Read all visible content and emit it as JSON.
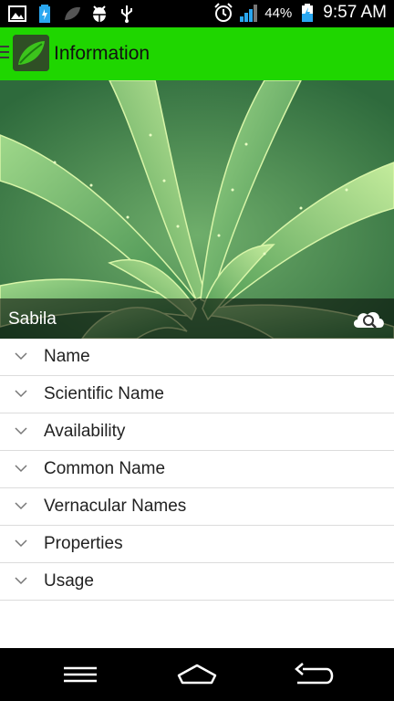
{
  "status_bar": {
    "battery_percent": "44%",
    "time": "9:57 AM",
    "icons": [
      "gallery-icon",
      "battery-saver-icon",
      "leaf-icon",
      "android-debug-icon",
      "usb-icon",
      "alarm-icon",
      "signal-icon",
      "battery-charging-icon"
    ]
  },
  "action_bar": {
    "title": "Information",
    "color": "#1fd600"
  },
  "hero": {
    "caption": "Sabila",
    "action_icon": "cloud-search-icon"
  },
  "sections": [
    {
      "label": "Name"
    },
    {
      "label": "Scientific Name"
    },
    {
      "label": "Availability"
    },
    {
      "label": "Common Name"
    },
    {
      "label": "Vernacular Names"
    },
    {
      "label": "Properties"
    },
    {
      "label": "Usage"
    }
  ],
  "nav_bar": {
    "buttons": [
      "menu-icon",
      "home-icon",
      "back-icon"
    ]
  }
}
